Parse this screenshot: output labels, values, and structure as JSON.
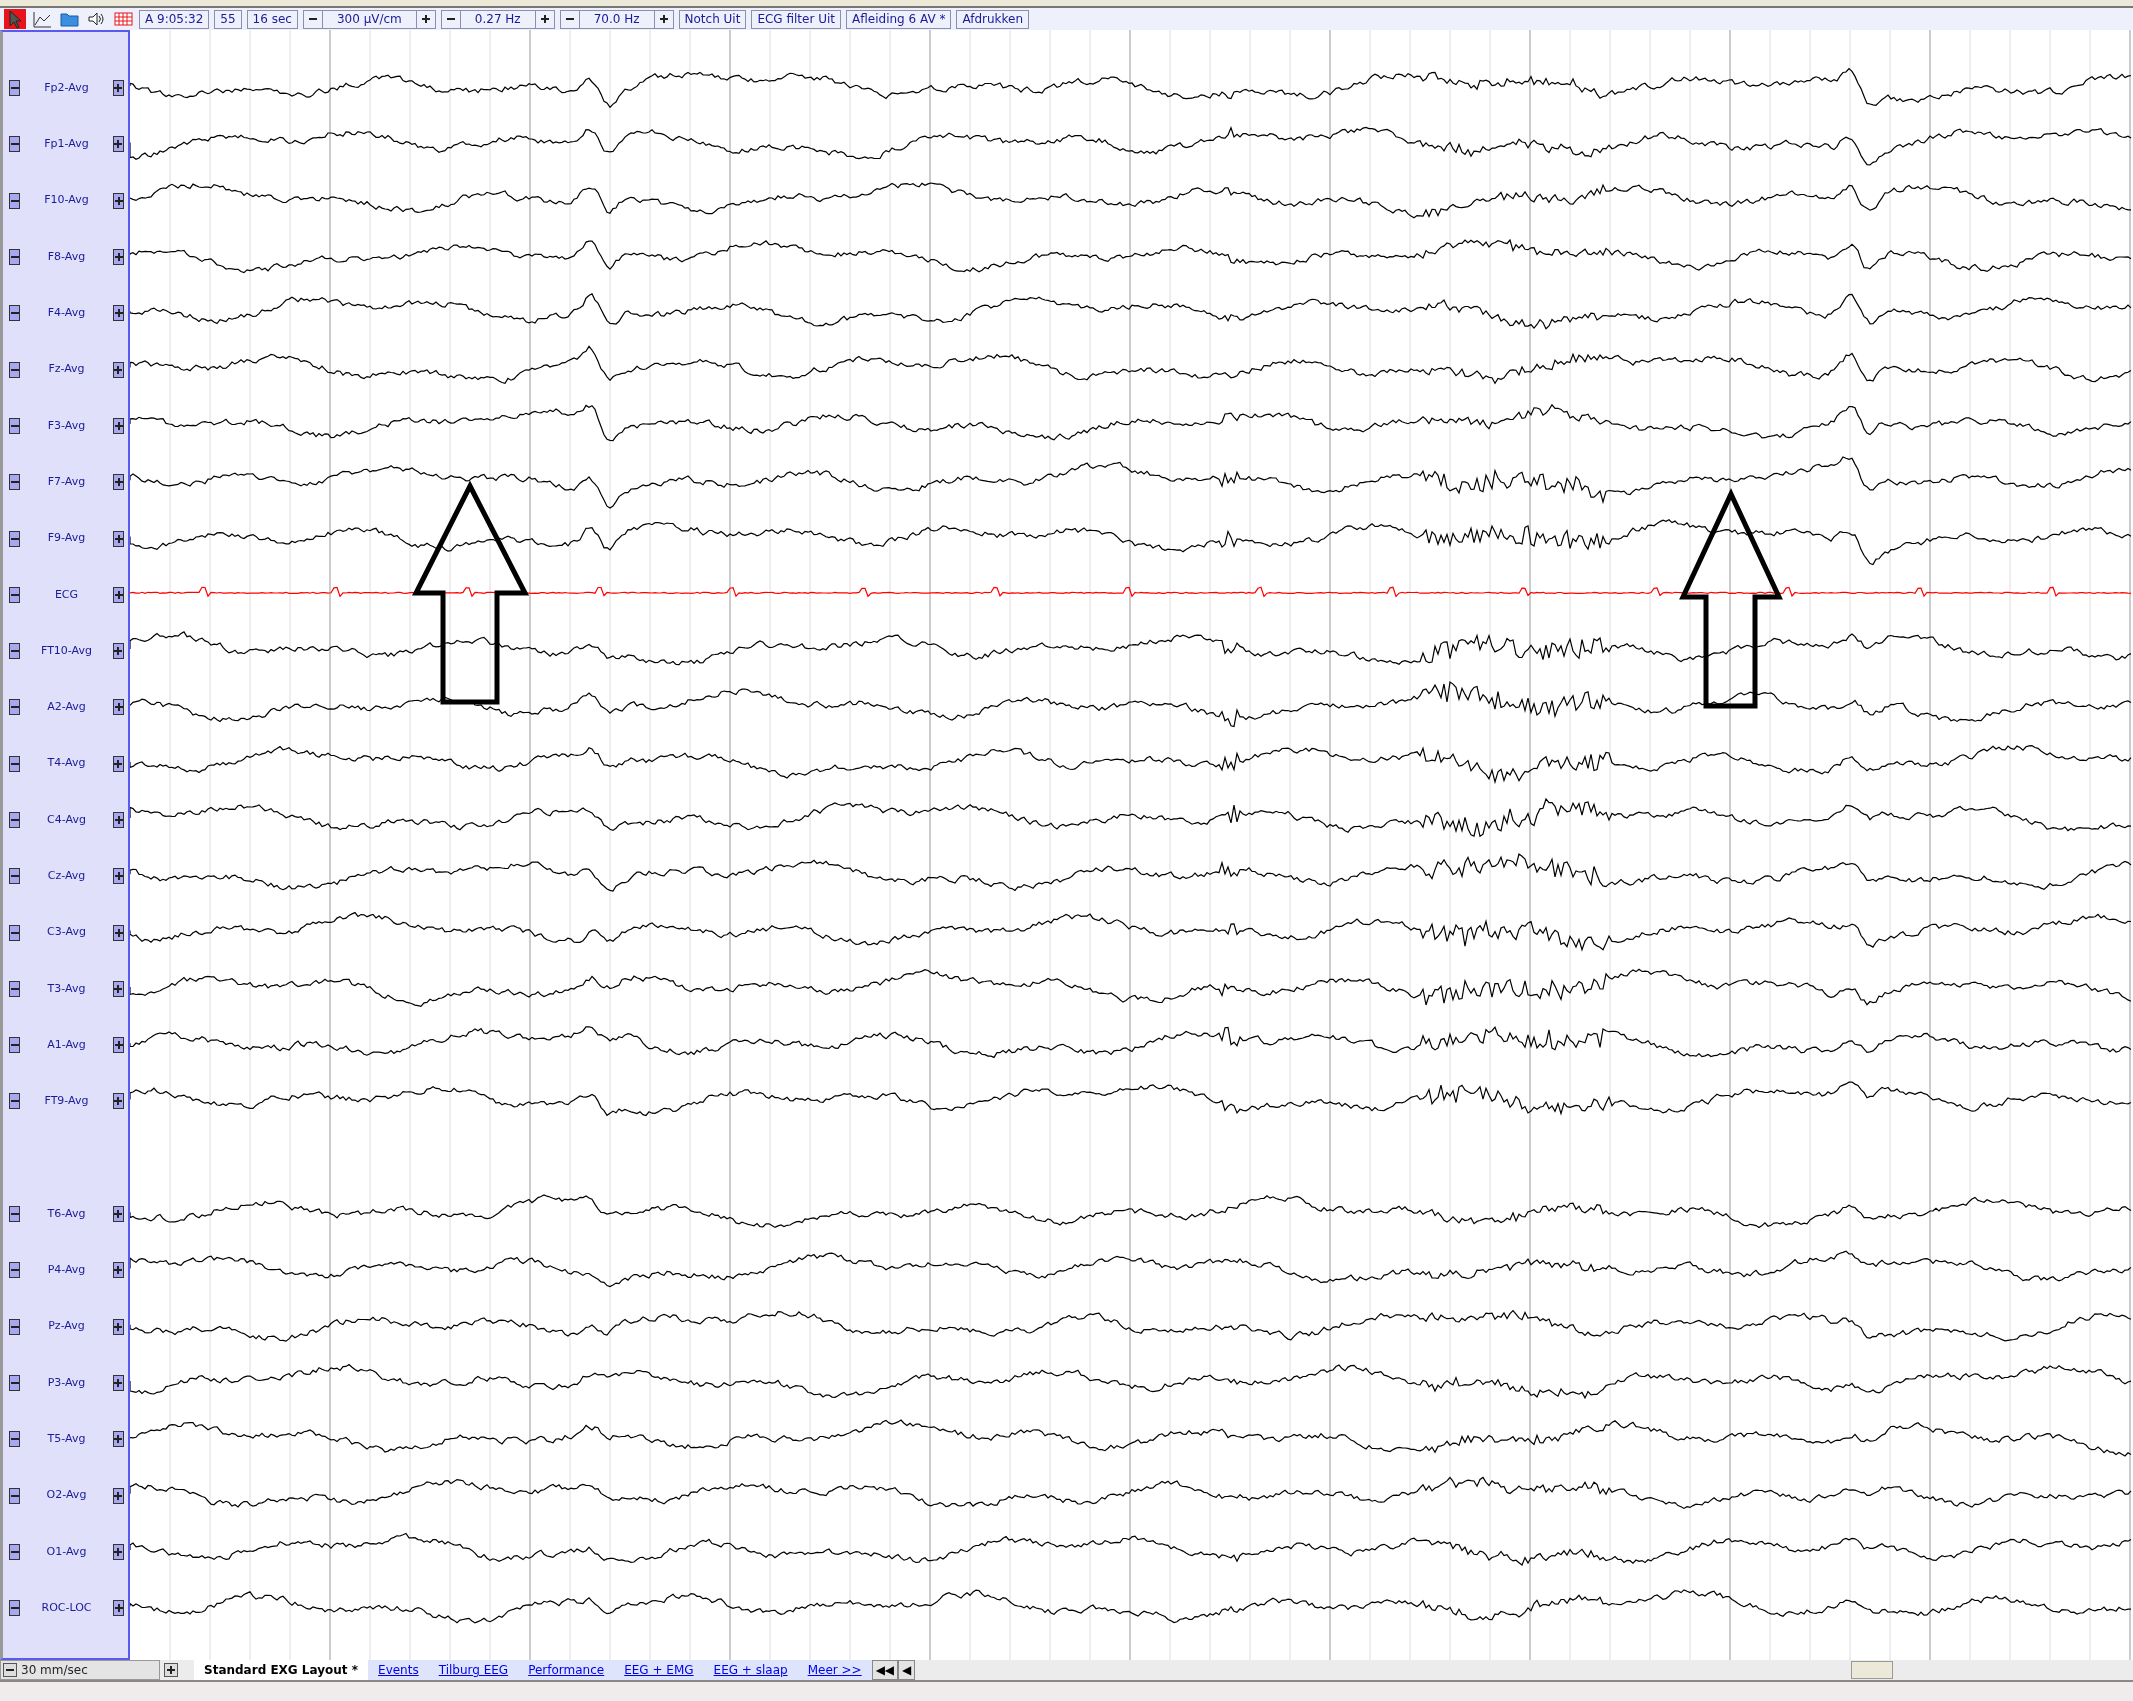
{
  "toolbar": {
    "tools": [
      {
        "selected": true
      },
      {
        "selected": false
      },
      {
        "selected": false
      },
      {
        "selected": false
      },
      {
        "selected": false
      }
    ],
    "controls": [
      {
        "kind": "field",
        "value": "A 9:05:32"
      },
      {
        "kind": "field",
        "value": "55"
      },
      {
        "kind": "field",
        "value": "16 sec"
      },
      {
        "kind": "stepper",
        "value": "300 µV/cm"
      },
      {
        "kind": "stepper",
        "value": "0.27 Hz"
      },
      {
        "kind": "stepper",
        "value": "70.0 Hz"
      },
      {
        "kind": "button",
        "value": "Notch Uit"
      },
      {
        "kind": "button",
        "value": "ECG filter Uit"
      },
      {
        "kind": "button",
        "value": "Afleiding 6 AV *"
      },
      {
        "kind": "button",
        "value": "Afdrukken"
      }
    ]
  },
  "channels": [
    {
      "kind": "channel",
      "label": "Fp2-Avg",
      "color": "#000000"
    },
    {
      "kind": "channel",
      "label": "Fp1-Avg",
      "color": "#000000"
    },
    {
      "kind": "channel",
      "label": "F10-Avg",
      "color": "#000000"
    },
    {
      "kind": "channel",
      "label": "F8-Avg",
      "color": "#000000"
    },
    {
      "kind": "channel",
      "label": "F4-Avg",
      "color": "#000000"
    },
    {
      "kind": "channel",
      "label": "Fz-Avg",
      "color": "#000000"
    },
    {
      "kind": "channel",
      "label": "F3-Avg",
      "color": "#000000"
    },
    {
      "kind": "channel",
      "label": "F7-Avg",
      "color": "#000000"
    },
    {
      "kind": "channel",
      "label": "F9-Avg",
      "color": "#000000"
    },
    {
      "kind": "channel",
      "label": "ECG",
      "color": "#ff0000"
    },
    {
      "kind": "channel",
      "label": "FT10-Avg",
      "color": "#000000"
    },
    {
      "kind": "channel",
      "label": "A2-Avg",
      "color": "#000000"
    },
    {
      "kind": "channel",
      "label": "T4-Avg",
      "color": "#000000"
    },
    {
      "kind": "channel",
      "label": "C4-Avg",
      "color": "#000000"
    },
    {
      "kind": "channel",
      "label": "Cz-Avg",
      "color": "#000000"
    },
    {
      "kind": "channel",
      "label": "C3-Avg",
      "color": "#000000"
    },
    {
      "kind": "channel",
      "label": "T3-Avg",
      "color": "#000000"
    },
    {
      "kind": "channel",
      "label": "A1-Avg",
      "color": "#000000"
    },
    {
      "kind": "channel",
      "label": "FT9-Avg",
      "color": "#000000"
    },
    {
      "kind": "spacer"
    },
    {
      "kind": "channel",
      "label": "T6-Avg",
      "color": "#000000"
    },
    {
      "kind": "channel",
      "label": "P4-Avg",
      "color": "#000000"
    },
    {
      "kind": "channel",
      "label": "Pz-Avg",
      "color": "#000000"
    },
    {
      "kind": "channel",
      "label": "P3-Avg",
      "color": "#000000"
    },
    {
      "kind": "channel",
      "label": "T5-Avg",
      "color": "#000000"
    },
    {
      "kind": "channel",
      "label": "O2-Avg",
      "color": "#000000"
    },
    {
      "kind": "channel",
      "label": "O1-Avg",
      "color": "#000000"
    },
    {
      "kind": "channel",
      "label": "ROC-LOC",
      "color": "#000000"
    }
  ],
  "bottom_bar": {
    "speed": "30 mm/sec",
    "tabs": [
      {
        "label": "Standard EXG Layout *",
        "selected": true
      },
      {
        "label": "Events",
        "selected": false
      },
      {
        "label": "Tilburg EEG",
        "selected": false
      },
      {
        "label": "Performance",
        "selected": false
      },
      {
        "label": "EEG + EMG",
        "selected": false
      },
      {
        "label": "EEG + slaap",
        "selected": false
      },
      {
        "label": "Meer >>",
        "selected": false
      }
    ],
    "nav_buttons": [
      "◀◀",
      "◀"
    ]
  }
}
